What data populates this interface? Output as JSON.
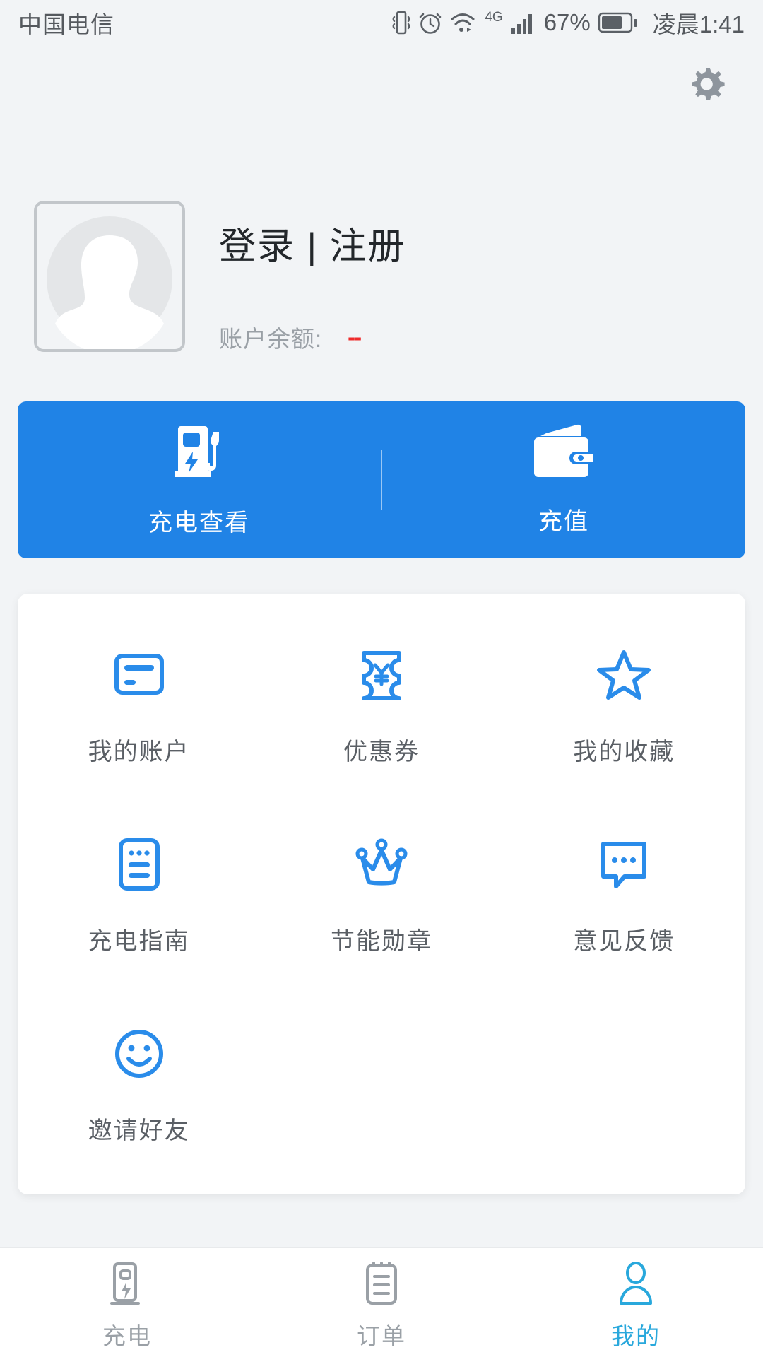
{
  "status_bar": {
    "carrier": "中国电信",
    "battery_percent": "67%",
    "time": "凌晨1:41",
    "network": "4G",
    "icons": [
      "vibrate-icon",
      "alarm-icon",
      "wifi-icon",
      "network-4g-icon",
      "signal-icon",
      "battery-icon"
    ]
  },
  "header": {
    "settings_icon": "gear-icon"
  },
  "profile": {
    "avatar_icon": "default-avatar-icon",
    "login_label": "登录 | 注册",
    "balance_label": "账户余额:",
    "balance_value": "--",
    "balance_color": "#ef2b2b"
  },
  "action_bar": {
    "background_color": "#2083e6",
    "items": [
      {
        "icon": "charging-pile-icon",
        "label": "充电查看"
      },
      {
        "icon": "wallet-icon",
        "label": "充值"
      }
    ]
  },
  "grid": {
    "accent_color": "#2a8cea",
    "items": [
      {
        "icon": "card-icon",
        "label": "我的账户"
      },
      {
        "icon": "coupon-icon",
        "label": "优惠券"
      },
      {
        "icon": "star-icon",
        "label": "我的收藏"
      },
      {
        "icon": "guide-icon",
        "label": "充电指南"
      },
      {
        "icon": "crown-icon",
        "label": "节能勋章"
      },
      {
        "icon": "chat-icon",
        "label": "意见反馈"
      },
      {
        "icon": "smiley-icon",
        "label": "邀请好友"
      }
    ]
  },
  "bottom_nav": {
    "active_color": "#29a8dc",
    "inactive_color": "#9aa0a6",
    "items": [
      {
        "icon": "charging-pile-nav-icon",
        "label": "充电",
        "active": false
      },
      {
        "icon": "order-list-nav-icon",
        "label": "订单",
        "active": false
      },
      {
        "icon": "person-nav-icon",
        "label": "我的",
        "active": true
      }
    ]
  }
}
